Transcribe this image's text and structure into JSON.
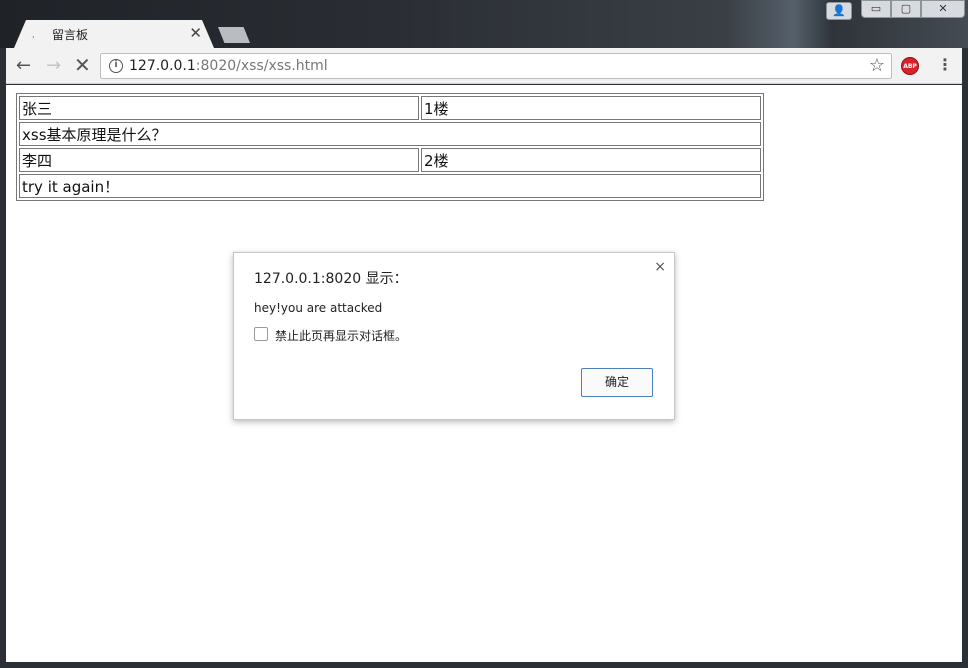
{
  "window": {
    "controls": {
      "minimize": "▭",
      "maximize": "▢",
      "close": "✕"
    }
  },
  "tab": {
    "title": "留言板",
    "close_label": "✕"
  },
  "toolbar": {
    "url_host": "127.0.0.1",
    "url_path": ":8020/xss/xss.html",
    "abp_label": "ABP"
  },
  "board": {
    "rows": [
      {
        "name": "张三",
        "floor": "1楼",
        "message": "xss基本原理是什么？"
      },
      {
        "name": "李四",
        "floor": "2楼",
        "message": "try it again！"
      }
    ]
  },
  "dialog": {
    "title": "127.0.0.1:8020 显示：",
    "message": "hey!you are attacked",
    "checkbox_label": "禁止此页再显示对话框。",
    "ok_label": "确定",
    "close_label": "×"
  }
}
